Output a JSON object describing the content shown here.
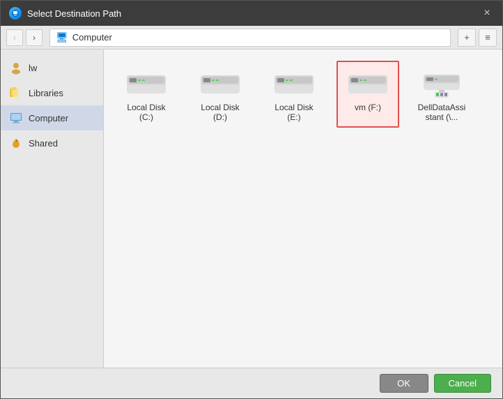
{
  "dialog": {
    "title": "Select Destination Path",
    "close_label": "×"
  },
  "toolbar": {
    "back_label": "‹",
    "forward_label": "›",
    "address": "Computer",
    "new_folder_label": "+",
    "view_label": "≡"
  },
  "sidebar": {
    "items": [
      {
        "id": "lw",
        "label": "lw",
        "icon": "user"
      },
      {
        "id": "libraries",
        "label": "Libraries",
        "icon": "folder"
      },
      {
        "id": "computer",
        "label": "Computer",
        "icon": "computer",
        "active": true
      },
      {
        "id": "shared",
        "label": "Shared",
        "icon": "shared"
      }
    ]
  },
  "files": [
    {
      "id": "c",
      "label": "Local Disk (C:)",
      "type": "disk",
      "selected": false
    },
    {
      "id": "d",
      "label": "Local Disk (D:)",
      "type": "disk",
      "selected": false
    },
    {
      "id": "e",
      "label": "Local Disk (E:)",
      "type": "disk",
      "selected": false
    },
    {
      "id": "f",
      "label": "vm (F:)",
      "type": "disk",
      "selected": true
    },
    {
      "id": "dell",
      "label": "DellDataAssistant (\\...",
      "type": "network",
      "selected": false
    }
  ],
  "footer": {
    "ok_label": "OK",
    "cancel_label": "Cancel"
  }
}
